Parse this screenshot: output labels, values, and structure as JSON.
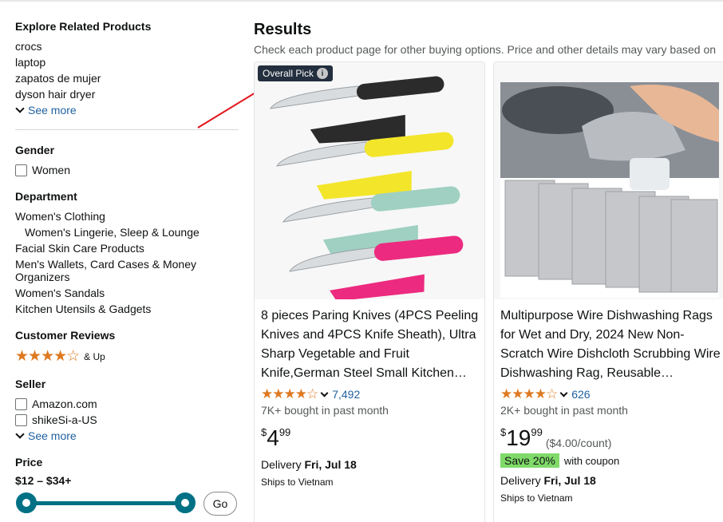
{
  "sidebar": {
    "explore": {
      "heading": "Explore Related Products",
      "items": [
        "crocs",
        "laptop",
        "zapatos de mujer",
        "dyson hair dryer"
      ],
      "see_more": "See more"
    },
    "gender": {
      "heading": "Gender",
      "options": [
        "Women"
      ]
    },
    "department": {
      "heading": "Department",
      "items": [
        "Women's Clothing",
        "Women's Lingerie, Sleep & Lounge",
        "Facial Skin Care Products",
        "Men's Wallets, Card Cases & Money Organizers",
        "Women's Sandals",
        "Kitchen Utensils & Gadgets"
      ]
    },
    "reviews": {
      "heading": "Customer Reviews",
      "stars": 4,
      "label": "& Up"
    },
    "seller": {
      "heading": "Seller",
      "options": [
        "Amazon.com",
        "shikeSi-a-US"
      ],
      "see_more": "See more"
    },
    "price": {
      "heading": "Price",
      "range": "$12 – $34+",
      "go_label": "Go"
    }
  },
  "main": {
    "title": "Results",
    "subtitle": "Check each product page for other buying options. Price and other details may vary based on",
    "products": [
      {
        "badge": "Overall Pick",
        "title": "8 pieces Paring Knives (4PCS Peeling Knives and 4PCS Knife Sheath), Ultra Sharp Vegetable and Fruit Knife,German Steel Small Kitchen…",
        "rating": 4.5,
        "reviews": "7,492",
        "bought": "7K+ bought in past month",
        "price_symbol": "$",
        "price_whole": "4",
        "price_fraction": "99",
        "delivery_prefix": "Delivery ",
        "delivery_date": "Fri, Jul 18",
        "ships": "Ships to Vietnam"
      },
      {
        "title": "Multipurpose Wire Dishwashing Rags for Wet and Dry, 2024 New Non-Scratch Wire Dishcloth Scrubbing Wire Dishwashing Rag, Reusable…",
        "rating": 4.5,
        "reviews": "626",
        "bought": "2K+ bought in past month",
        "price_symbol": "$",
        "price_whole": "19",
        "price_fraction": "99",
        "unit_price": "($4.00/count)",
        "coupon_save": "Save 20%",
        "coupon_text": "with coupon",
        "delivery_prefix": "Delivery ",
        "delivery_date": "Fri, Jul 18",
        "ships": "Ships to Vietnam"
      }
    ]
  },
  "colors": {
    "link": "#2162a1",
    "star": "#de7921",
    "slider": "#007185",
    "badge_bg": "#232f3e",
    "coupon_bg": "#7fda69",
    "annotation_arrow": "#e3141b"
  }
}
